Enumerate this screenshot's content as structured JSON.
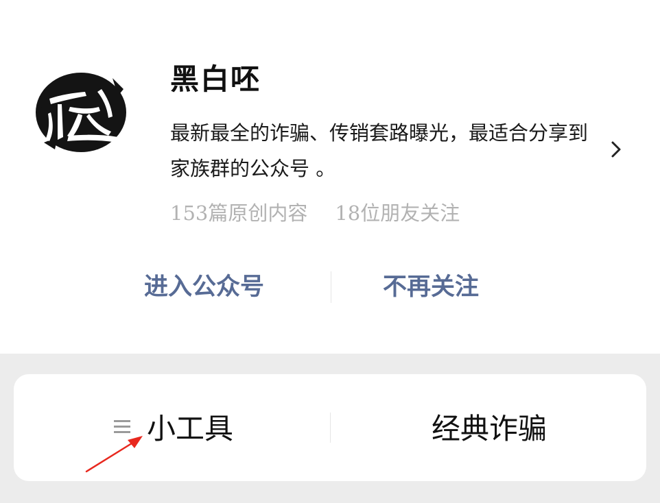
{
  "account": {
    "name": "黑白呸",
    "description": "最新最全的诈骗、传销套路曝光，最适合分享到家族群的公众号 。",
    "stats": {
      "original_count": "153篇原创内容",
      "friends_following": "18位朋友关注"
    },
    "avatar_icon": "ink-calligraphy-logo-icon"
  },
  "actions": {
    "enter_label": "进入公众号",
    "unfollow_label": "不再关注"
  },
  "menu": {
    "items": [
      {
        "label": "小工具",
        "icon": "menu-lines-icon"
      },
      {
        "label": "经典诈骗"
      }
    ]
  },
  "colors": {
    "link_blue": "#576b95",
    "muted_gray": "#b2b2b2",
    "page_gray": "#ececec",
    "annotation_red": "#e8281e"
  }
}
